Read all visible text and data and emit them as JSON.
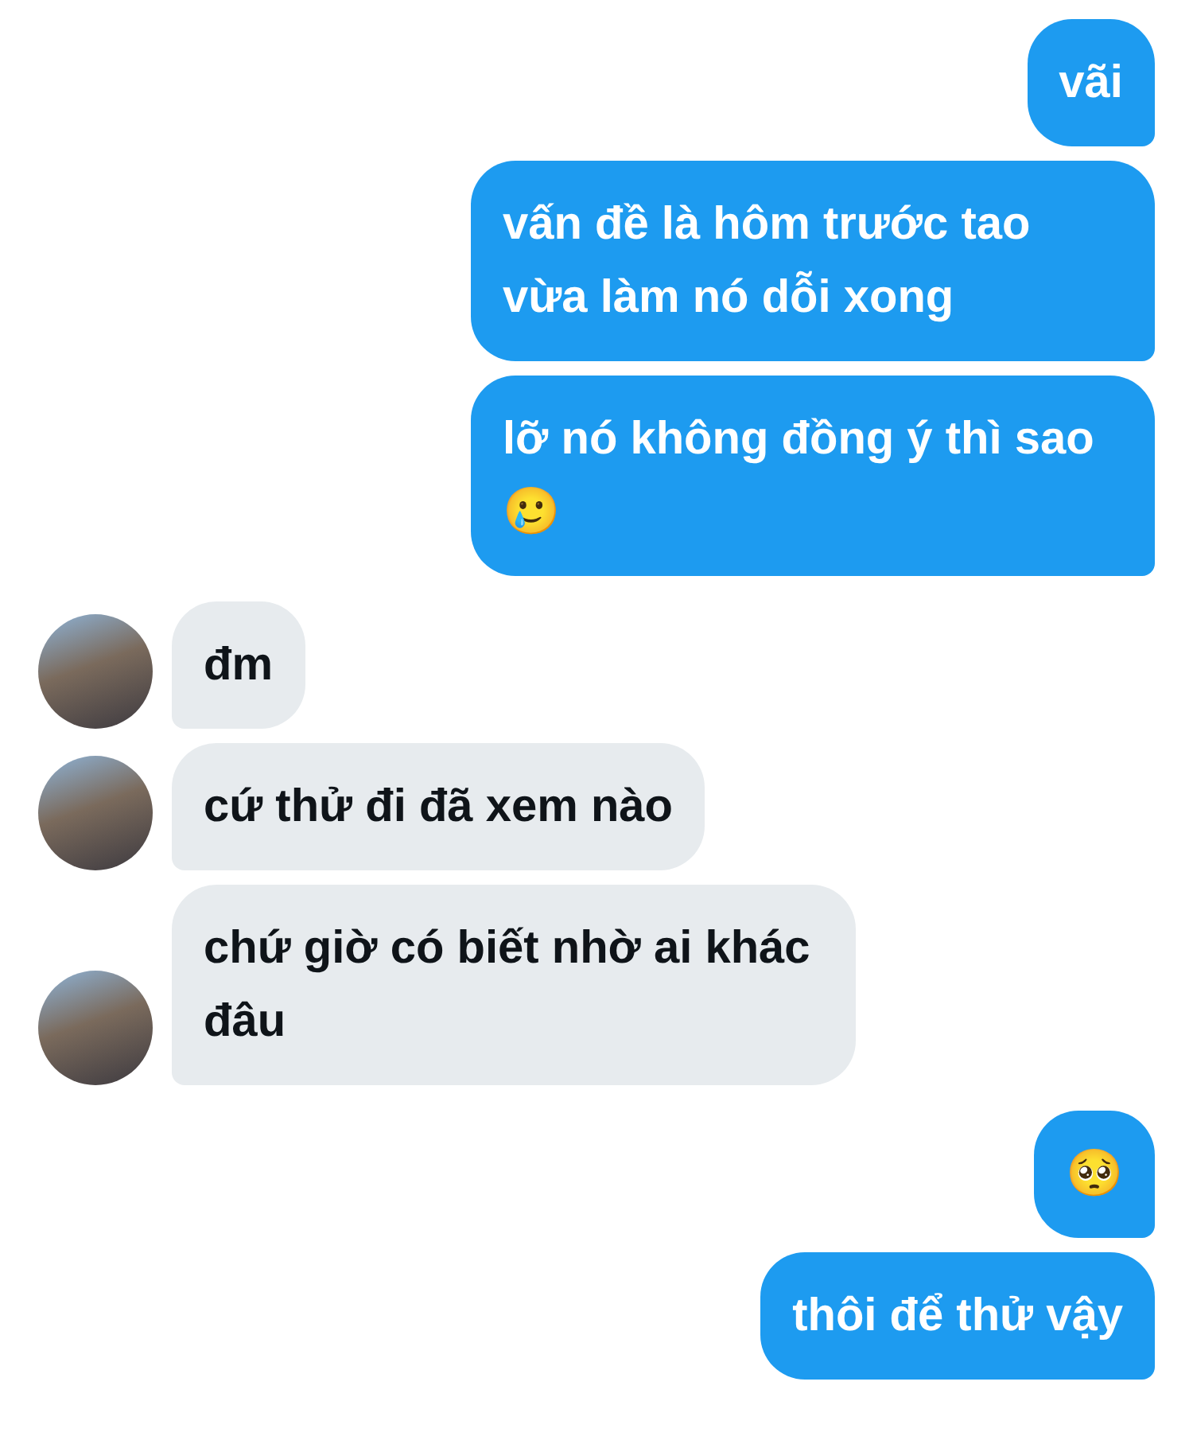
{
  "messages": [
    {
      "kind": "sent",
      "text": "vãi"
    },
    {
      "kind": "sent",
      "text": "vấn đề là hôm trước tao vừa làm nó dỗi xong"
    },
    {
      "kind": "sent",
      "text": "lỡ nó không đồng ý thì sao 🥲"
    },
    {
      "kind": "received",
      "text": "đm"
    },
    {
      "kind": "received",
      "text": "cứ thử đi đã xem nào"
    },
    {
      "kind": "received",
      "text": "chứ giờ có biết nhờ ai khác đâu"
    },
    {
      "kind": "sent",
      "text": "🥺"
    },
    {
      "kind": "sent",
      "text": "thôi để thử vậy"
    }
  ]
}
